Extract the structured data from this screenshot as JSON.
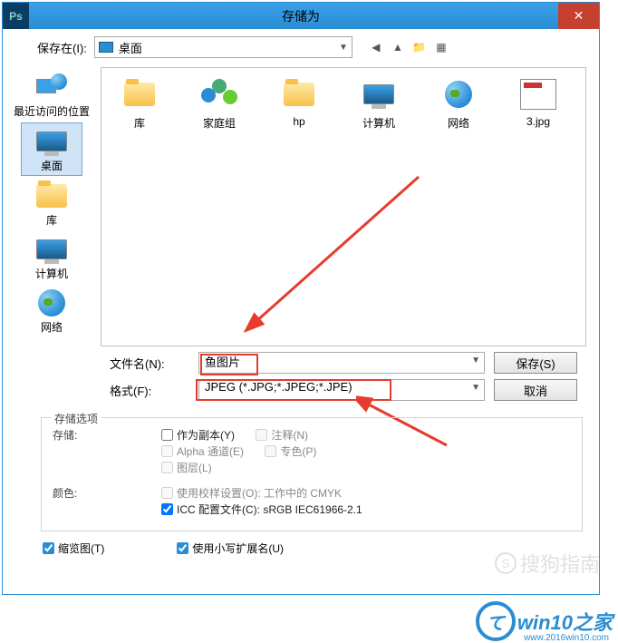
{
  "titlebar": {
    "app_icon": "Ps",
    "title": "存储为",
    "close": "✕"
  },
  "toprow": {
    "label": "保存在(I):",
    "location": "桌面",
    "nav": {
      "back": "◀",
      "up": "▲",
      "new": "📁",
      "view": "▦"
    }
  },
  "sidebar": [
    {
      "id": "recent",
      "label": "最近访问的位置"
    },
    {
      "id": "desktop",
      "label": "桌面",
      "selected": true
    },
    {
      "id": "library",
      "label": "库"
    },
    {
      "id": "computer",
      "label": "计算机"
    },
    {
      "id": "network",
      "label": "网络"
    }
  ],
  "files": [
    {
      "id": "lib",
      "label": "库"
    },
    {
      "id": "homegroup",
      "label": "家庭组"
    },
    {
      "id": "hp",
      "label": "hp"
    },
    {
      "id": "computer",
      "label": "计算机"
    },
    {
      "id": "network",
      "label": "网络"
    },
    {
      "id": "jpg3",
      "label": "3.jpg"
    }
  ],
  "fields": {
    "filename_label": "文件名(N):",
    "filename_value": "鱼图片",
    "format_label": "格式(F):",
    "format_value": "JPEG (*.JPG;*.JPEG;*.JPE)",
    "save_btn": "保存(S)",
    "cancel_btn": "取消"
  },
  "options": {
    "header": "存储选项",
    "storage_label": "存储:",
    "as_copy": "作为副本(Y)",
    "annotations": "注释(N)",
    "alpha": "Alpha 通道(E)",
    "spot": "专色(P)",
    "layers": "图层(L)",
    "color_label": "颜色:",
    "proof": "使用校样设置(O): 工作中的 CMYK",
    "icc": "ICC 配置文件(C): sRGB IEC61966-2.1"
  },
  "bottom": {
    "thumbnail": "缩览图(T)",
    "lowercase": "使用小写扩展名(U)"
  },
  "watermarks": {
    "sogou": "搜狗指南",
    "win10_c": "て",
    "win10_txt": "win10之家",
    "win10_url": "www.2016win10.com"
  }
}
